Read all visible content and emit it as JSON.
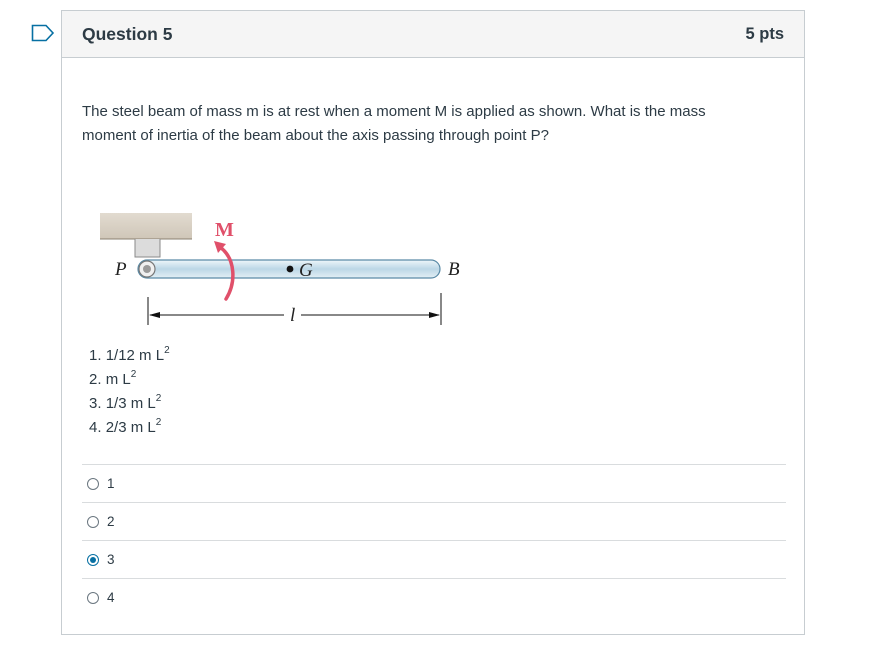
{
  "question": {
    "title": "Question 5",
    "points": "5 pts",
    "text": "The steel beam of mass m is at rest when a moment M is applied as shown. What is the mass moment of inertia of the beam about the axis passing through point P?"
  },
  "figure": {
    "moment_label": "M",
    "pivot_label": "P",
    "center_label": "G",
    "end_label": "B",
    "length_label": "l",
    "colors": {
      "moment": "#e0506a",
      "beam": "#cfe3ee",
      "beam_edge": "#5a8aa6",
      "support": "#d8d0c4"
    }
  },
  "options": [
    {
      "num": "1.",
      "coef": "1/12 m L",
      "exp": "2"
    },
    {
      "num": "2.",
      "coef": "m L",
      "exp": "2"
    },
    {
      "num": "3.",
      "coef": "1/3 m L",
      "exp": "2"
    },
    {
      "num": "4.",
      "coef": "2/3 m L",
      "exp": "2"
    }
  ],
  "answers": [
    {
      "label": "1",
      "selected": false
    },
    {
      "label": "2",
      "selected": false
    },
    {
      "label": "3",
      "selected": true
    },
    {
      "label": "4",
      "selected": false
    }
  ],
  "accent_color": "#0770a3"
}
